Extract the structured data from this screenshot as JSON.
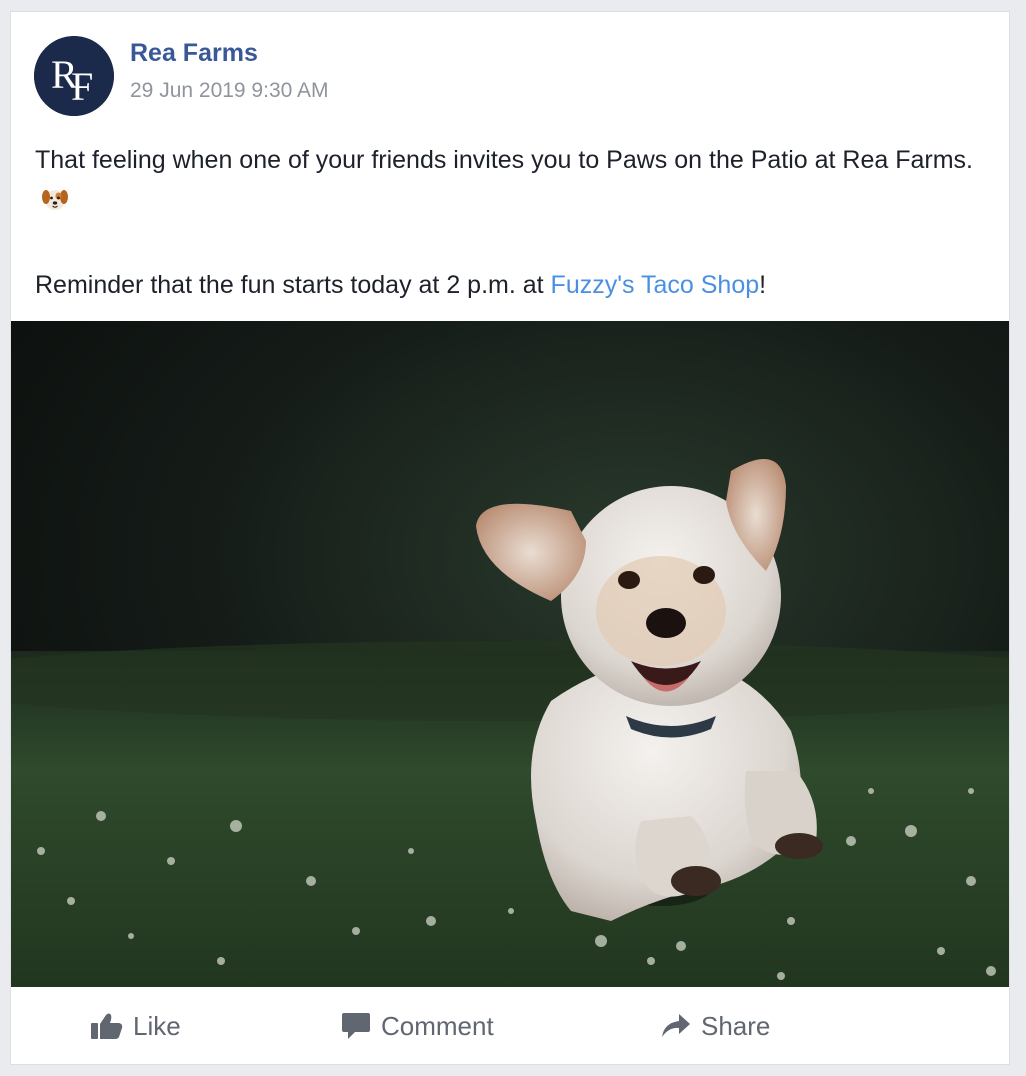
{
  "post": {
    "page_name": "Rea Farms",
    "avatar_monogram": "RF",
    "timestamp": "29 Jun 2019 9:30 AM",
    "text_line1_prefix": "That feeling when one of your friends invites you to Paws on the Patio at Rea Farms.",
    "emoji": "dog-face-emoji",
    "text_line2_prefix": "Reminder that the fun starts today at 2 p.m. at ",
    "text_line2_link": "Fuzzy's Taco Shop",
    "text_line2_suffix": "!",
    "link_color": "#4a90e2",
    "name_color": "#385898"
  },
  "actions": {
    "like_label": "Like",
    "comment_label": "Comment",
    "share_label": "Share"
  },
  "icons": {
    "like": "thumbs-up-icon",
    "comment": "speech-bubble-icon",
    "share": "share-arrow-icon"
  }
}
